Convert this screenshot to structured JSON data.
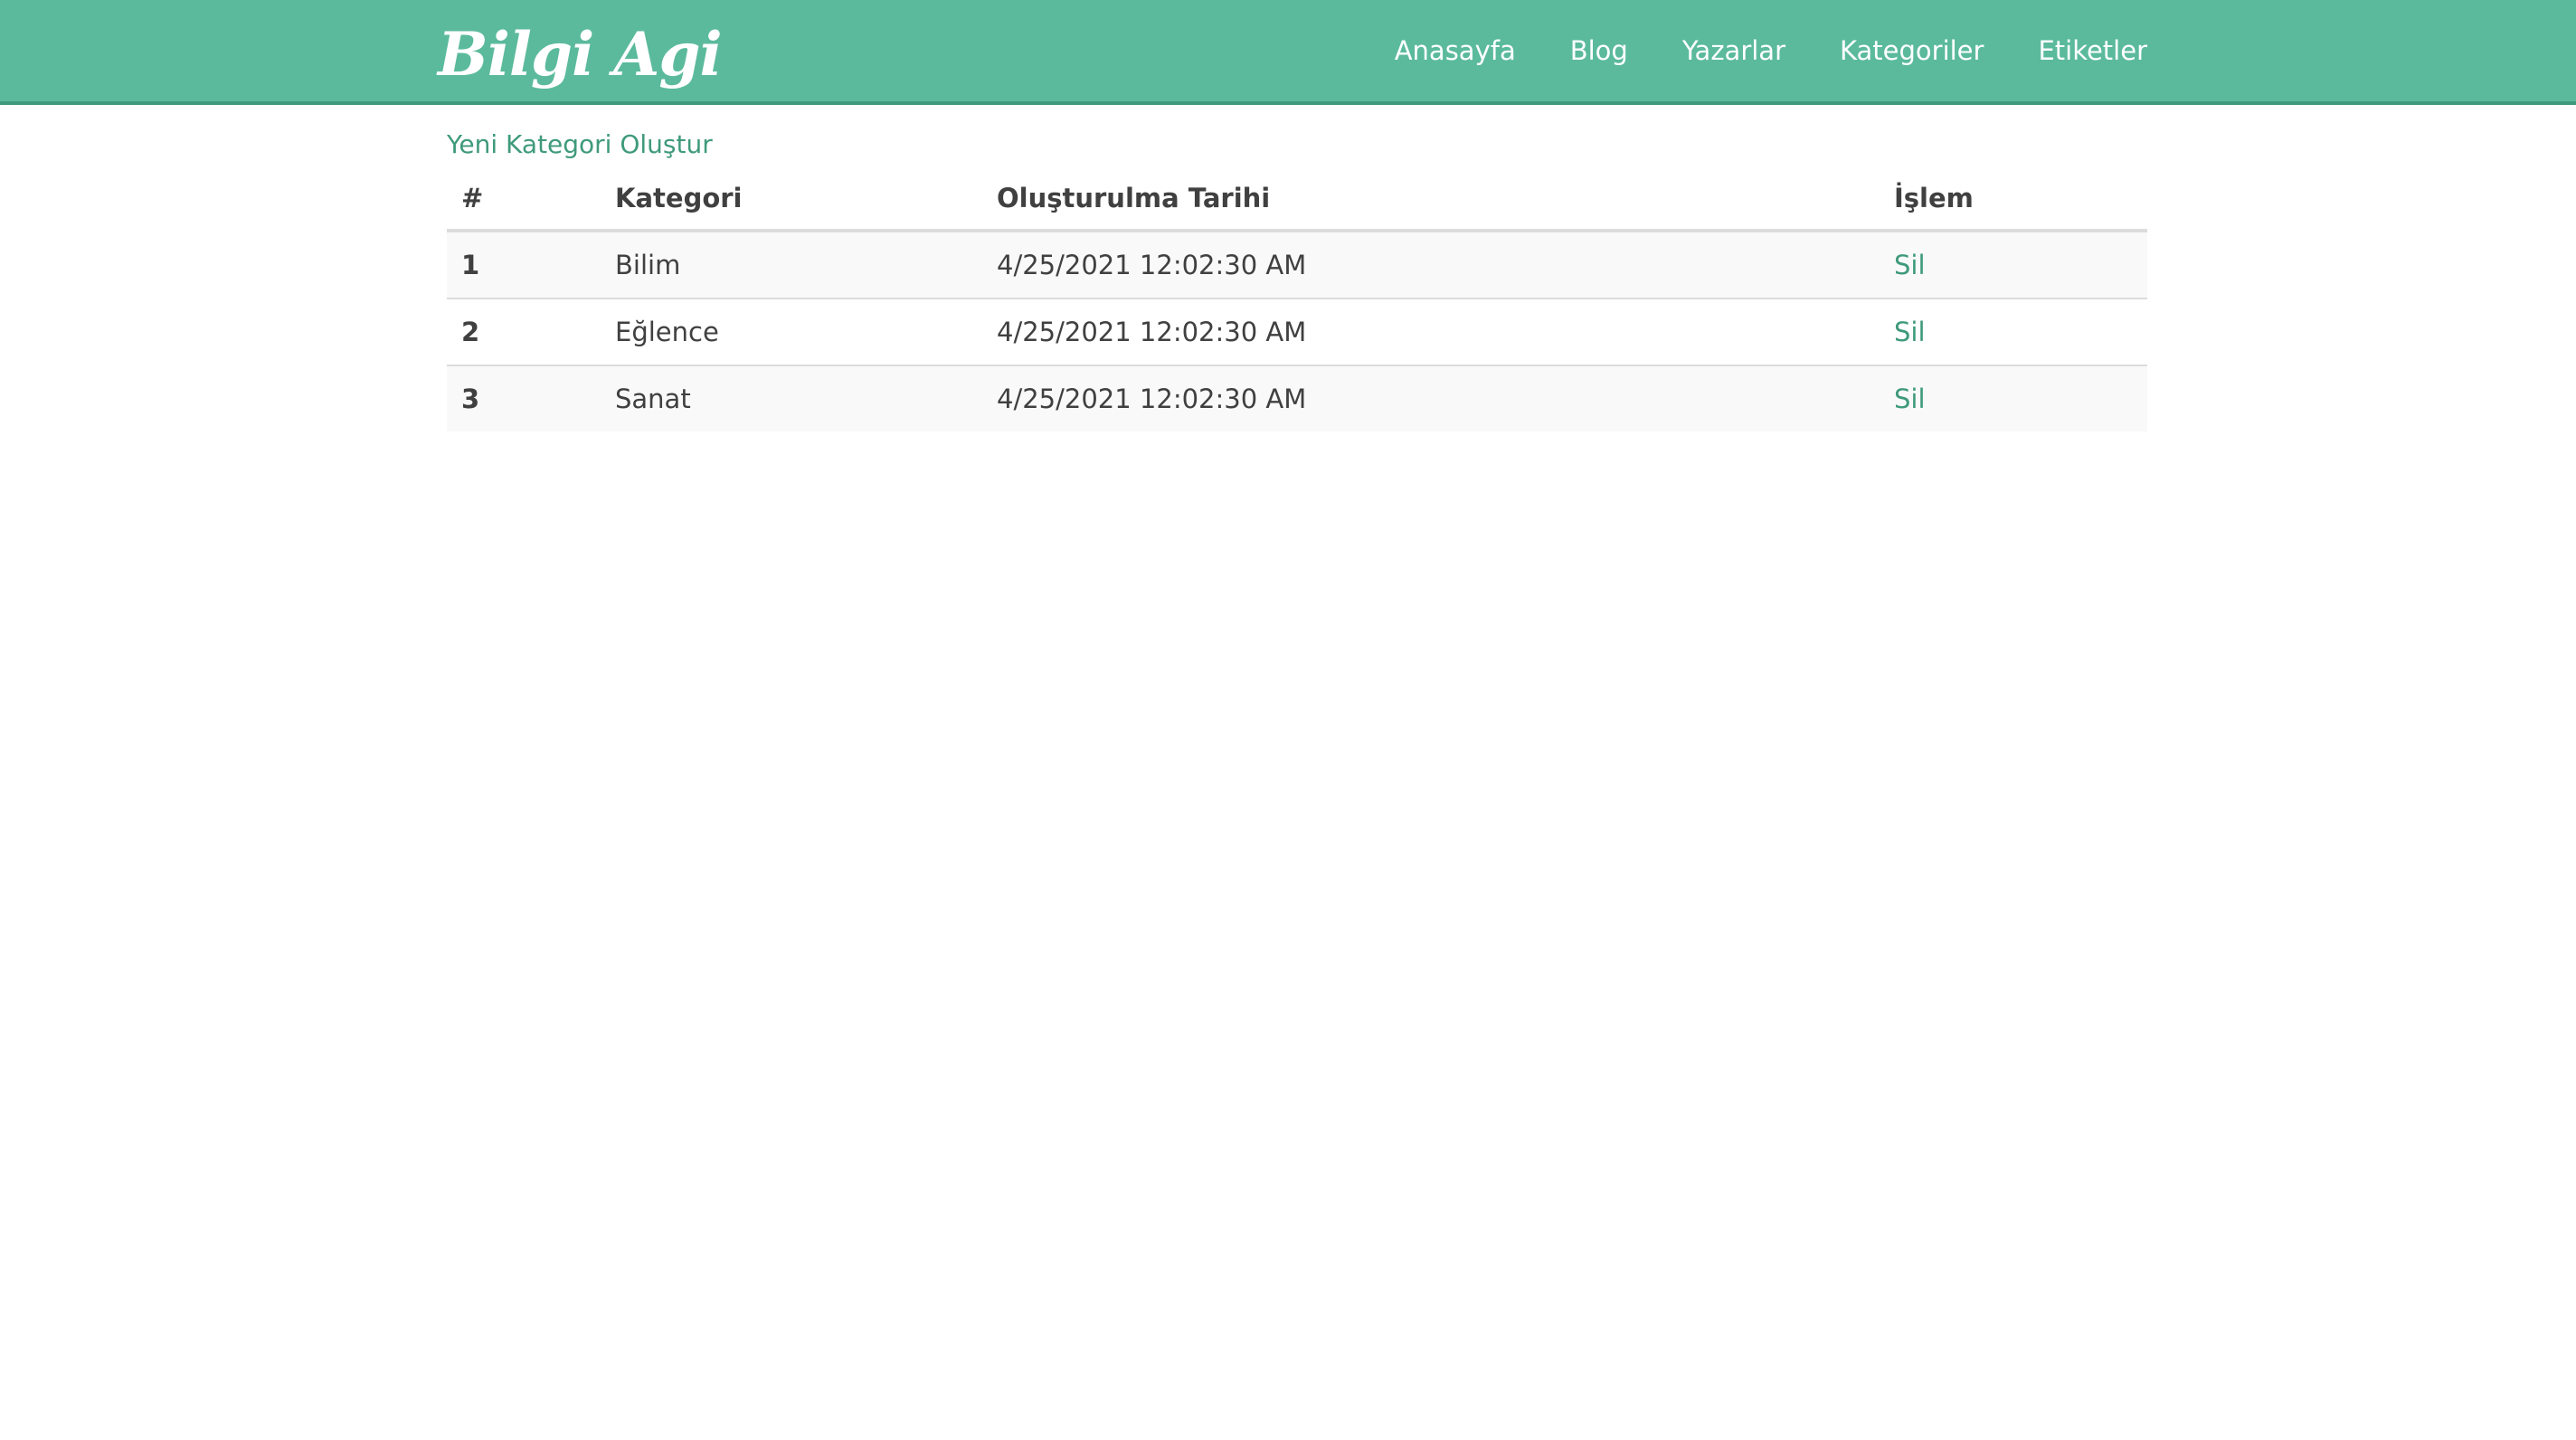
{
  "brand": "Bilgi Agi",
  "nav": {
    "items": [
      "Anasayfa",
      "Blog",
      "Yazarlar",
      "Kategoriler",
      "Etiketler"
    ]
  },
  "main": {
    "new_link": "Yeni Kategori Oluştur",
    "table": {
      "headers": [
        "#",
        "Kategori",
        "Oluşturulma Tarihi",
        "İşlem"
      ],
      "rows": [
        {
          "id": "1",
          "name": "Bilim",
          "date": "4/25/2021 12:02:30 AM",
          "action": "Sil"
        },
        {
          "id": "2",
          "name": "Eğlence",
          "date": "4/25/2021 12:02:30 AM",
          "action": "Sil"
        },
        {
          "id": "3",
          "name": "Sanat",
          "date": "4/25/2021 12:02:30 AM",
          "action": "Sil"
        }
      ]
    }
  },
  "colors": {
    "header_bg": "#5bba9c",
    "accent": "#3f9a7c"
  }
}
